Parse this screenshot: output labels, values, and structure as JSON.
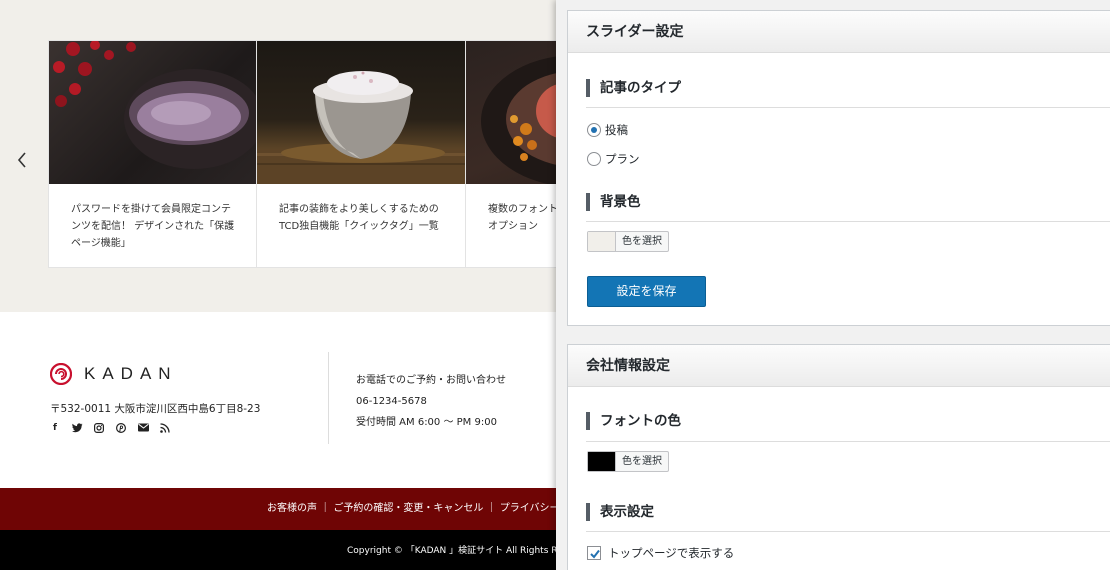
{
  "slider": {
    "cards": [
      {
        "text": "パスワードを掛けて会員限定コンテンツを配信！ デザインされた「保護ページ機能」"
      },
      {
        "text": "記事の装飾をより美しくするためのTCD独自機能「クイックタグ」一覧"
      },
      {
        "text": "複数のフォントを使い分けたテーマオプション"
      }
    ]
  },
  "footer": {
    "logo_text": "KADAN",
    "address": "〒532-0011 大阪市淀川区西中島6丁目8-23",
    "social_icons": [
      "facebook-icon",
      "twitter-icon",
      "instagram-icon",
      "pinterest-icon",
      "mail-icon",
      "rss-icon"
    ],
    "contact_heading": "お電話でのご予約・お問い合わせ",
    "phone": "06-1234-5678",
    "hours": "受付時間 AM 6:00 〜 PM 9:00",
    "nav_text": "お客様の声 ｜ ご予約の確認・変更・キャンセル ｜ プライバシーポリシー",
    "copyright": "Copyright © 「KADAN 」検証サイト All Rights Reserved."
  },
  "slider_settings": {
    "title": "スライダー設定",
    "article_type_label": "記事のタイプ",
    "options": [
      "投稿",
      "プラン"
    ],
    "selected_option": "投稿",
    "bg_color_label": "背景色",
    "bg_color": "#f1efea",
    "choose_color_label": "色を選択",
    "save_label": "設定を保存"
  },
  "company_settings": {
    "title": "会社情報設定",
    "font_color_label": "フォントの色",
    "font_color": "#000000",
    "choose_color_label": "色を選択",
    "display_label": "表示設定",
    "show_on_top_label": "トップページで表示する",
    "show_on_top_checked": true
  },
  "colors": {
    "accent": "#1375b5",
    "footer_nav_bg": "#6f0505",
    "logo_red": "#c8102e"
  }
}
